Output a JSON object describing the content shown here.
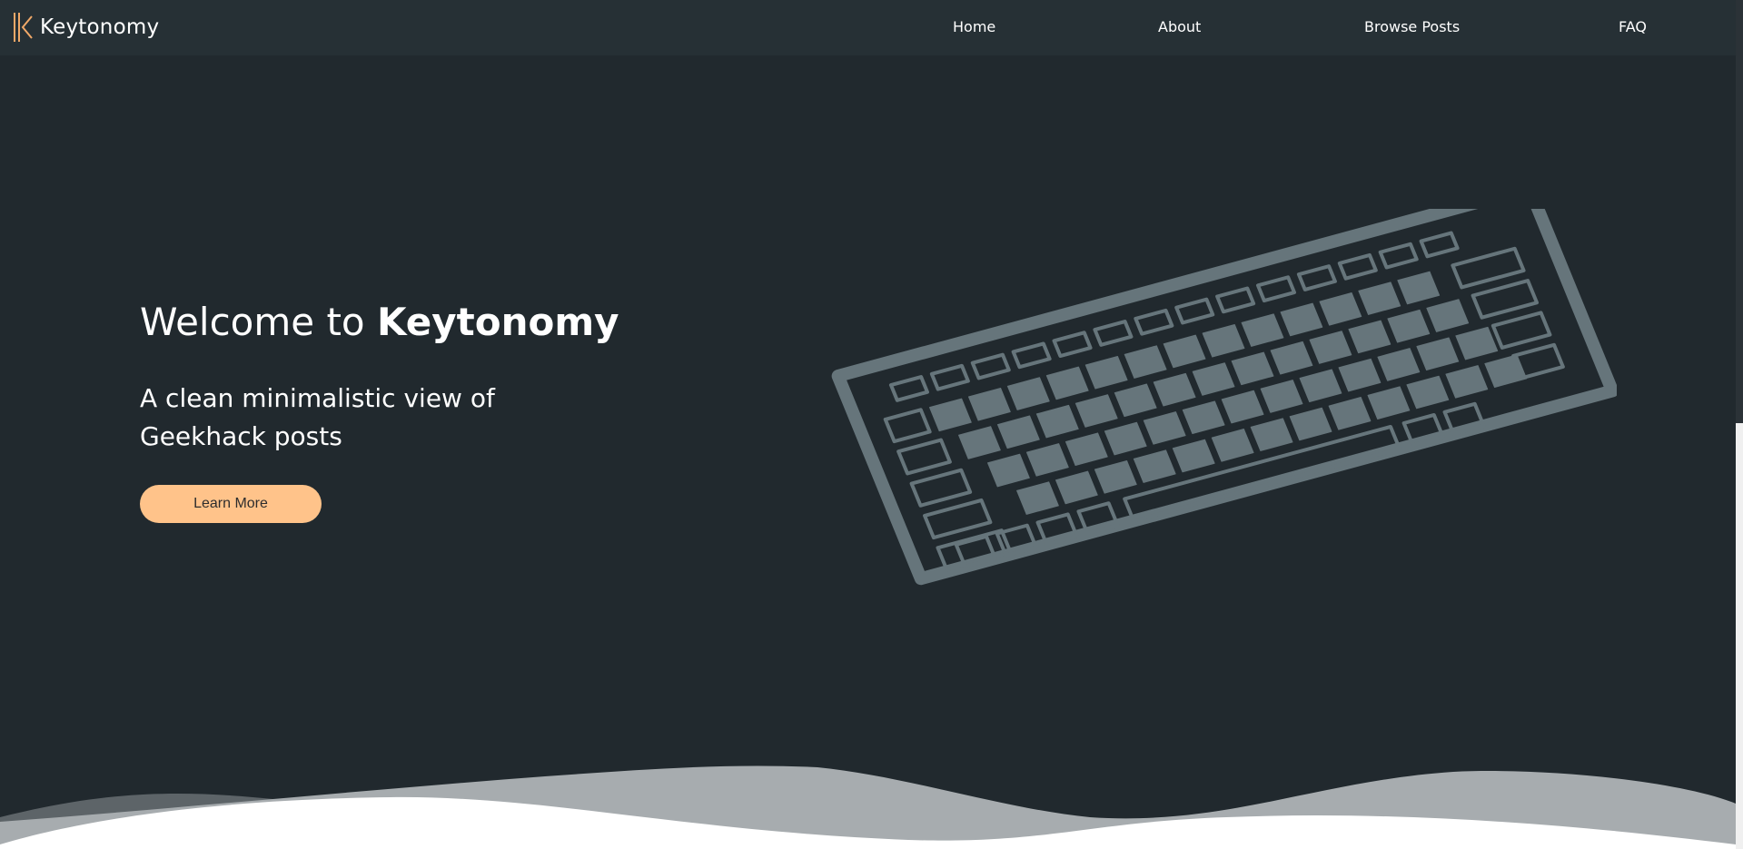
{
  "brand": {
    "name": "Keytonomy",
    "logo_icon": "double-k-logo",
    "logo_color": "#f0a868"
  },
  "nav": {
    "links": [
      {
        "label": "Home"
      },
      {
        "label": "About"
      },
      {
        "label": "Browse Posts"
      },
      {
        "label": "FAQ"
      }
    ]
  },
  "hero": {
    "title_prefix": "Welcome to ",
    "title_brand": "Keytonomy",
    "subtitle": "A clean minimalistic view of Geekhack posts",
    "button_label": "Learn More"
  },
  "colors": {
    "background": "#21292e",
    "navbar": "#263035",
    "accent": "#ffc38a",
    "illustration": "#66757b"
  },
  "illustration": {
    "icon": "keyboard-illustration"
  }
}
